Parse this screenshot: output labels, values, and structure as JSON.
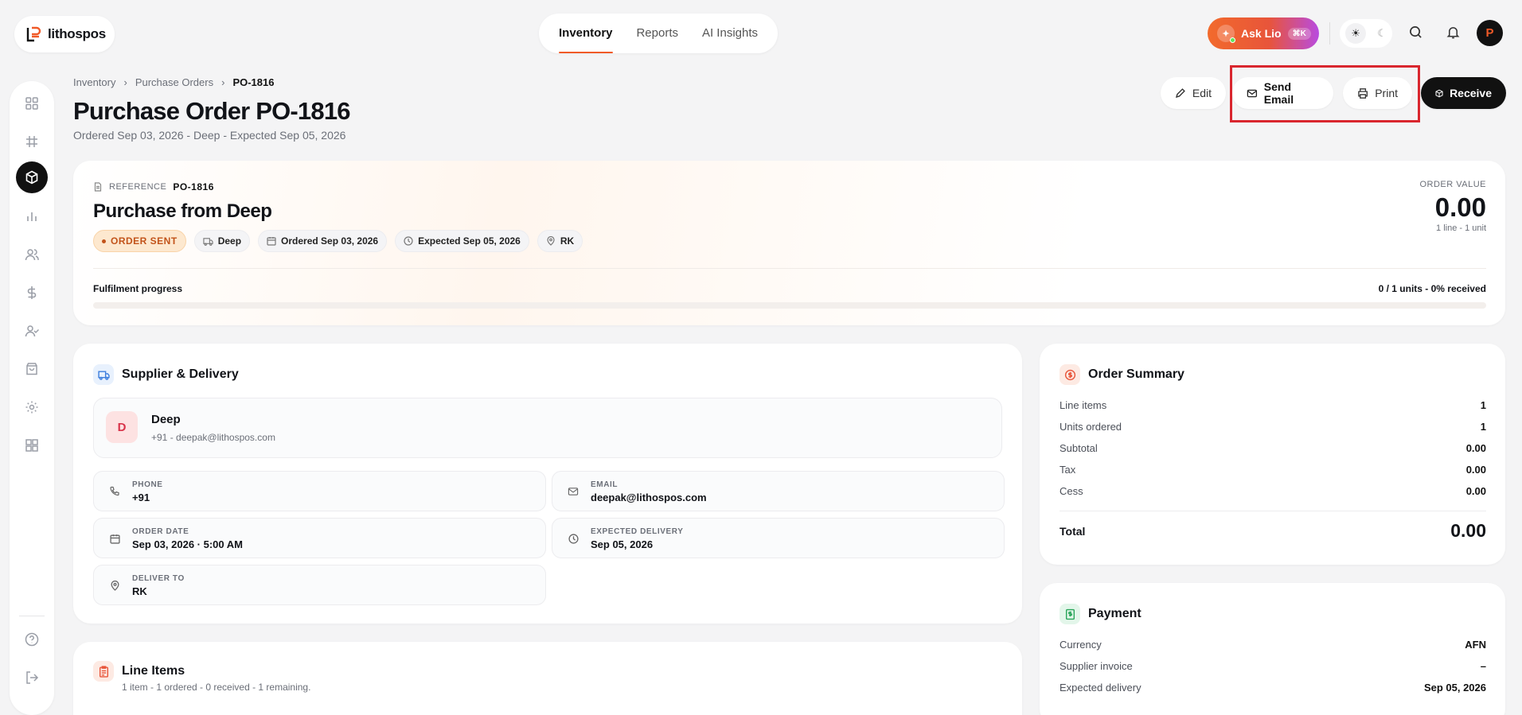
{
  "app": {
    "logo_text": "lithospos"
  },
  "topnav": {
    "tabs": [
      "Inventory",
      "Reports",
      "AI Insights"
    ],
    "active": "Inventory"
  },
  "header": {
    "ask_label": "Ask Lio",
    "ask_shortcut": "⌘K",
    "avatar_initial": "P"
  },
  "breadcrumb": [
    "Inventory",
    "Purchase Orders",
    "PO-1816"
  ],
  "page": {
    "title": "Purchase Order PO-1816",
    "subtitle": "Ordered Sep 03, 2026 - Deep - Expected Sep 05, 2026"
  },
  "actions": {
    "edit": "Edit",
    "send_email": "Send Email",
    "print": "Print",
    "receive": "Receive"
  },
  "hero": {
    "reference_label": "REFERENCE",
    "reference_value": "PO-1816",
    "title": "Purchase from Deep",
    "status": "ORDER SENT",
    "tags": [
      "Deep",
      "Ordered Sep 03, 2026",
      "Expected Sep 05, 2026",
      "RK"
    ],
    "order_value_label": "ORDER VALUE",
    "order_value": "0.00",
    "order_value_sub": "1 line - 1 unit",
    "progress_label": "Fulfilment progress",
    "progress_value": "0 / 1 units - 0% received",
    "progress_fraction": 0
  },
  "supplier": {
    "section_title": "Supplier & Delivery",
    "avatar": "D",
    "name": "Deep",
    "contact": "+91 - deepak@lithospos.com",
    "fields": {
      "phone": {
        "label": "PHONE",
        "value": "+91"
      },
      "email": {
        "label": "EMAIL",
        "value": "deepak@lithospos.com"
      },
      "order_date": {
        "label": "ORDER DATE",
        "value": "Sep 03, 2026 · 5:00 AM"
      },
      "expected": {
        "label": "EXPECTED DELIVERY",
        "value": "Sep 05, 2026"
      },
      "deliver_to": {
        "label": "DELIVER TO",
        "value": "RK"
      }
    }
  },
  "summary": {
    "title": "Order Summary",
    "rows": [
      {
        "label": "Line items",
        "value": "1"
      },
      {
        "label": "Units ordered",
        "value": "1"
      },
      {
        "label": "Subtotal",
        "value": "0.00"
      },
      {
        "label": "Tax",
        "value": "0.00"
      },
      {
        "label": "Cess",
        "value": "0.00"
      }
    ],
    "total_label": "Total",
    "total_value": "0.00"
  },
  "payment": {
    "title": "Payment",
    "rows": [
      {
        "label": "Currency",
        "value": "AFN"
      },
      {
        "label": "Supplier invoice",
        "value": "–"
      },
      {
        "label": "Expected delivery",
        "value": "Sep 05, 2026"
      }
    ]
  },
  "line_items": {
    "title": "Line Items",
    "subtitle": "1 item - 1 ordered - 0 received - 1 remaining."
  },
  "colors": {
    "accent": "#f05a28",
    "dark": "#111111",
    "status_bg": "#fde8cf",
    "highlight": "#d9262e"
  }
}
